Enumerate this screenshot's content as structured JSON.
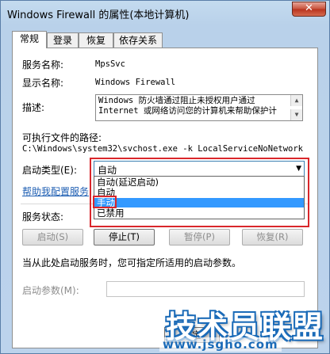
{
  "window": {
    "title": "Windows Firewall 的属性(本地计算机)",
    "close_glyph": "✕"
  },
  "tabs": [
    {
      "label": "常规",
      "active": true
    },
    {
      "label": "登录",
      "active": false
    },
    {
      "label": "恢复",
      "active": false
    },
    {
      "label": "依存关系",
      "active": false
    }
  ],
  "general": {
    "service_name_label": "服务名称:",
    "service_name_value": "MpsSvc",
    "display_name_label": "显示名称:",
    "display_name_value": "Windows Firewall",
    "description_label": "描述:",
    "description_lines": [
      "Windows 防火墙通过阻止未授权用户通过",
      "Internet 或网络访问您的计算机来帮助保护计"
    ],
    "exe_path_label": "可执行文件的路径:",
    "exe_path_value": "C:\\Windows\\system32\\svchost.exe -k LocalServiceNoNetwork",
    "startup_type_label": "启动类型(E):",
    "startup_type_value": "自动",
    "startup_type_options": [
      "自动(延迟启动)",
      "自动",
      "手动",
      "已禁用"
    ],
    "startup_type_highlighted": "手动",
    "help_link": "帮助我配置服务",
    "service_status_label": "服务状态:",
    "buttons": {
      "start": "启动(S)",
      "stop": "停止(T)",
      "pause": "暂停(P)",
      "resume": "恢复(R)"
    },
    "start_hint": "当从此处启动服务时，您可指定所适用的启动参数。",
    "start_params_label": "启动参数(M):",
    "start_params_value": ""
  },
  "footer": {
    "ok_partial": "确定"
  },
  "watermark": {
    "text": "技术员联盟",
    "url": "www.jsgho.com"
  },
  "colors": {
    "highlight": "#3399ff",
    "annotation_red": "#d9262b",
    "link": "#1f5fb3"
  }
}
